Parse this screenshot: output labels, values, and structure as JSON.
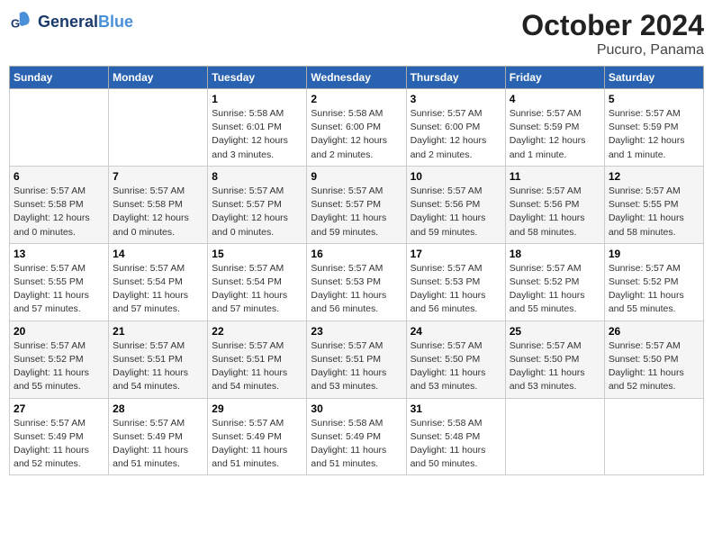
{
  "header": {
    "logo_general": "General",
    "logo_blue": "Blue",
    "month": "October 2024",
    "location": "Pucuro, Panama"
  },
  "days_of_week": [
    "Sunday",
    "Monday",
    "Tuesday",
    "Wednesday",
    "Thursday",
    "Friday",
    "Saturday"
  ],
  "weeks": [
    [
      {
        "day": "",
        "info": ""
      },
      {
        "day": "",
        "info": ""
      },
      {
        "day": "1",
        "sunrise": "5:58 AM",
        "sunset": "6:01 PM",
        "daylight": "12 hours and 3 minutes."
      },
      {
        "day": "2",
        "sunrise": "5:58 AM",
        "sunset": "6:00 PM",
        "daylight": "12 hours and 2 minutes."
      },
      {
        "day": "3",
        "sunrise": "5:57 AM",
        "sunset": "6:00 PM",
        "daylight": "12 hours and 2 minutes."
      },
      {
        "day": "4",
        "sunrise": "5:57 AM",
        "sunset": "5:59 PM",
        "daylight": "12 hours and 1 minute."
      },
      {
        "day": "5",
        "sunrise": "5:57 AM",
        "sunset": "5:59 PM",
        "daylight": "12 hours and 1 minute."
      }
    ],
    [
      {
        "day": "6",
        "sunrise": "5:57 AM",
        "sunset": "5:58 PM",
        "daylight": "12 hours and 0 minutes."
      },
      {
        "day": "7",
        "sunrise": "5:57 AM",
        "sunset": "5:58 PM",
        "daylight": "12 hours and 0 minutes."
      },
      {
        "day": "8",
        "sunrise": "5:57 AM",
        "sunset": "5:57 PM",
        "daylight": "12 hours and 0 minutes."
      },
      {
        "day": "9",
        "sunrise": "5:57 AM",
        "sunset": "5:57 PM",
        "daylight": "11 hours and 59 minutes."
      },
      {
        "day": "10",
        "sunrise": "5:57 AM",
        "sunset": "5:56 PM",
        "daylight": "11 hours and 59 minutes."
      },
      {
        "day": "11",
        "sunrise": "5:57 AM",
        "sunset": "5:56 PM",
        "daylight": "11 hours and 58 minutes."
      },
      {
        "day": "12",
        "sunrise": "5:57 AM",
        "sunset": "5:55 PM",
        "daylight": "11 hours and 58 minutes."
      }
    ],
    [
      {
        "day": "13",
        "sunrise": "5:57 AM",
        "sunset": "5:55 PM",
        "daylight": "11 hours and 57 minutes."
      },
      {
        "day": "14",
        "sunrise": "5:57 AM",
        "sunset": "5:54 PM",
        "daylight": "11 hours and 57 minutes."
      },
      {
        "day": "15",
        "sunrise": "5:57 AM",
        "sunset": "5:54 PM",
        "daylight": "11 hours and 57 minutes."
      },
      {
        "day": "16",
        "sunrise": "5:57 AM",
        "sunset": "5:53 PM",
        "daylight": "11 hours and 56 minutes."
      },
      {
        "day": "17",
        "sunrise": "5:57 AM",
        "sunset": "5:53 PM",
        "daylight": "11 hours and 56 minutes."
      },
      {
        "day": "18",
        "sunrise": "5:57 AM",
        "sunset": "5:52 PM",
        "daylight": "11 hours and 55 minutes."
      },
      {
        "day": "19",
        "sunrise": "5:57 AM",
        "sunset": "5:52 PM",
        "daylight": "11 hours and 55 minutes."
      }
    ],
    [
      {
        "day": "20",
        "sunrise": "5:57 AM",
        "sunset": "5:52 PM",
        "daylight": "11 hours and 55 minutes."
      },
      {
        "day": "21",
        "sunrise": "5:57 AM",
        "sunset": "5:51 PM",
        "daylight": "11 hours and 54 minutes."
      },
      {
        "day": "22",
        "sunrise": "5:57 AM",
        "sunset": "5:51 PM",
        "daylight": "11 hours and 54 minutes."
      },
      {
        "day": "23",
        "sunrise": "5:57 AM",
        "sunset": "5:51 PM",
        "daylight": "11 hours and 53 minutes."
      },
      {
        "day": "24",
        "sunrise": "5:57 AM",
        "sunset": "5:50 PM",
        "daylight": "11 hours and 53 minutes."
      },
      {
        "day": "25",
        "sunrise": "5:57 AM",
        "sunset": "5:50 PM",
        "daylight": "11 hours and 53 minutes."
      },
      {
        "day": "26",
        "sunrise": "5:57 AM",
        "sunset": "5:50 PM",
        "daylight": "11 hours and 52 minutes."
      }
    ],
    [
      {
        "day": "27",
        "sunrise": "5:57 AM",
        "sunset": "5:49 PM",
        "daylight": "11 hours and 52 minutes."
      },
      {
        "day": "28",
        "sunrise": "5:57 AM",
        "sunset": "5:49 PM",
        "daylight": "11 hours and 51 minutes."
      },
      {
        "day": "29",
        "sunrise": "5:57 AM",
        "sunset": "5:49 PM",
        "daylight": "11 hours and 51 minutes."
      },
      {
        "day": "30",
        "sunrise": "5:58 AM",
        "sunset": "5:49 PM",
        "daylight": "11 hours and 51 minutes."
      },
      {
        "day": "31",
        "sunrise": "5:58 AM",
        "sunset": "5:48 PM",
        "daylight": "11 hours and 50 minutes."
      },
      {
        "day": "",
        "info": ""
      },
      {
        "day": "",
        "info": ""
      }
    ]
  ],
  "labels": {
    "sunrise_prefix": "Sunrise: ",
    "sunset_prefix": "Sunset: ",
    "daylight_prefix": "Daylight: "
  }
}
